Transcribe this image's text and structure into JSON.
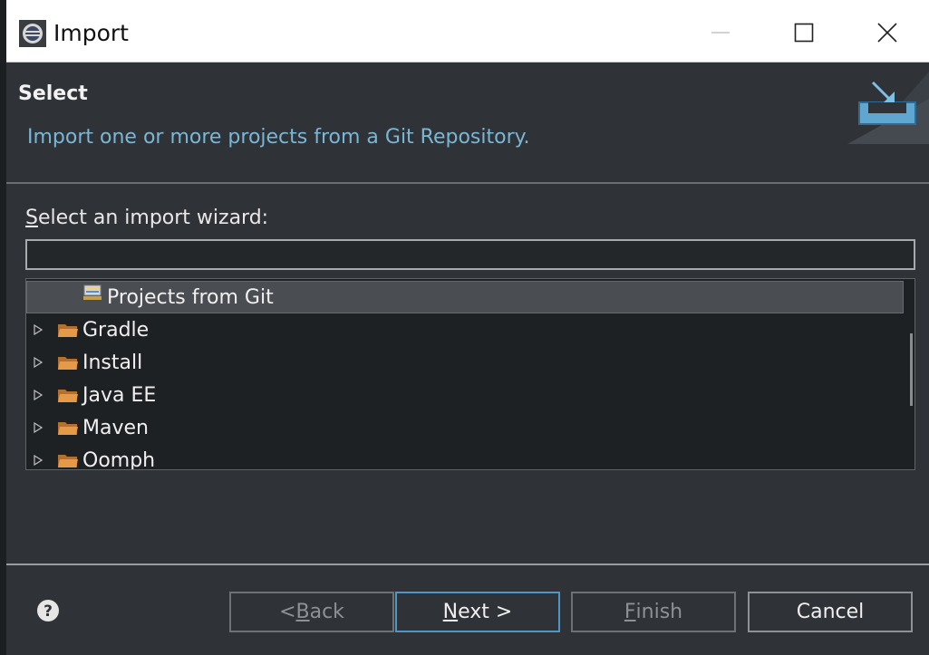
{
  "window": {
    "title": "Import",
    "controls": {
      "minimize": "minimize",
      "maximize": "maximize",
      "close": "close"
    }
  },
  "banner": {
    "title": "Select",
    "description": "Import one or more projects from a Git Repository."
  },
  "wizard": {
    "label_mnemonic": "S",
    "label_rest": "elect an import wizard:",
    "filter_value": "",
    "tree": [
      {
        "label": "Projects from Git",
        "type": "item",
        "selected": true,
        "icon": "git-repo-icon"
      },
      {
        "label": "Gradle",
        "type": "folder",
        "selected": false,
        "icon": "folder-icon"
      },
      {
        "label": "Install",
        "type": "folder",
        "selected": false,
        "icon": "folder-icon"
      },
      {
        "label": "Java EE",
        "type": "folder",
        "selected": false,
        "icon": "folder-icon"
      },
      {
        "label": "Maven",
        "type": "folder",
        "selected": false,
        "icon": "folder-icon"
      },
      {
        "label": "Oomph",
        "type": "folder",
        "selected": false,
        "icon": "folder-icon"
      }
    ]
  },
  "footer": {
    "back_prefix": "< ",
    "back_mnemonic": "B",
    "back_rest": "ack",
    "next_mnemonic": "N",
    "next_rest": "ext >",
    "finish_mnemonic": "F",
    "finish_rest": "inish",
    "cancel_label": "Cancel"
  },
  "colors": {
    "background": "#2f3337",
    "accent_text": "#79b6d7",
    "selection": "#4a4e53",
    "folder": "#d98a3e"
  }
}
